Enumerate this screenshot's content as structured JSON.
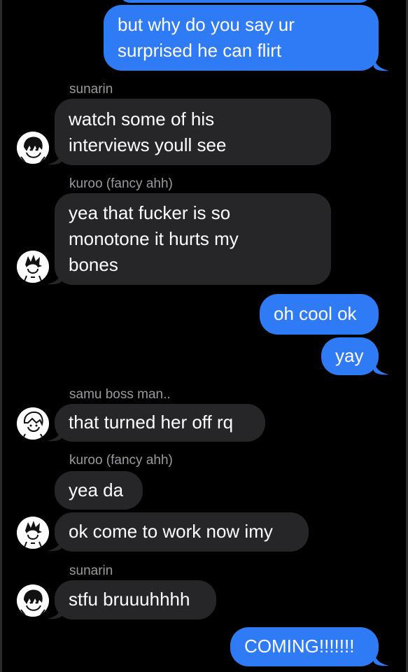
{
  "messages": [
    {
      "id": "m1",
      "type": "out",
      "text_lines": [
        "but why do you say ur",
        "surprised he can flirt"
      ]
    },
    {
      "id": "m2",
      "type": "in",
      "sender": "sunarin",
      "avatar": "sunarin-avatar",
      "text_lines": [
        "watch some of his",
        "interviews youll see"
      ]
    },
    {
      "id": "m3",
      "type": "in",
      "sender": "kuroo (fancy ahh)",
      "avatar": "kuroo-avatar",
      "text_lines": [
        "yea that fucker is so",
        "monotone it hurts my",
        "bones"
      ]
    },
    {
      "id": "m4",
      "type": "out",
      "text_lines": [
        "oh cool ok"
      ]
    },
    {
      "id": "m5",
      "type": "out",
      "text_lines": [
        "yay"
      ]
    },
    {
      "id": "m6",
      "type": "in",
      "sender": "samu boss man..",
      "avatar": "samu-avatar",
      "text_lines": [
        "that turned her off rq"
      ]
    },
    {
      "id": "m7",
      "type": "in",
      "sender": "kuroo (fancy ahh)",
      "text_lines": [
        "yea da"
      ]
    },
    {
      "id": "m8",
      "type": "in",
      "avatar": "kuroo-avatar",
      "text_lines": [
        "ok come to work now imy"
      ]
    },
    {
      "id": "m9",
      "type": "in",
      "sender": "sunarin",
      "avatar": "sunarin-avatar",
      "text_lines": [
        "stfu bruuuhhhh"
      ]
    },
    {
      "id": "m10",
      "type": "out",
      "text_lines": [
        "COMING!!!!!!!"
      ]
    }
  ],
  "colors": {
    "outgoing": "#2f7bf6",
    "incoming": "#262628",
    "sender": "#9a9aa0",
    "background": "#000000"
  }
}
